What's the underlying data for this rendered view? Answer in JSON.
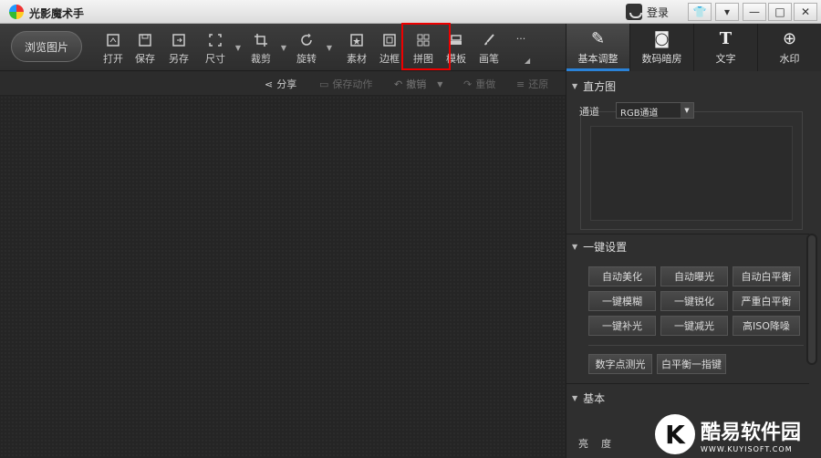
{
  "title_bar": {
    "app_title": "光影魔术手",
    "login_label": "登录",
    "btn_skin": "👕",
    "btn_menu": "▾",
    "btn_min": "—",
    "btn_max": "□",
    "btn_close": "✕"
  },
  "toolbar": {
    "browse_label": "浏览图片",
    "tools": [
      {
        "label": "打开",
        "icon": "open-icon"
      },
      {
        "label": "保存",
        "icon": "save-icon"
      },
      {
        "label": "另存",
        "icon": "save-as-icon"
      },
      {
        "label": "尺寸",
        "icon": "resize-icon"
      },
      {
        "label": "裁剪",
        "icon": "crop-icon"
      },
      {
        "label": "旋转",
        "icon": "rotate-icon"
      },
      {
        "label": "素材",
        "icon": "material-icon"
      },
      {
        "label": "边框",
        "icon": "frame-icon"
      },
      {
        "label": "拼图",
        "icon": "collage-icon"
      },
      {
        "label": "模板",
        "icon": "template-icon"
      },
      {
        "label": "画笔",
        "icon": "brush-icon"
      },
      {
        "label": "···",
        "icon": "more-icon"
      }
    ]
  },
  "subbar": {
    "share": "分享",
    "save_action": "保存动作",
    "undo": "撤销",
    "redo": "重做",
    "restore": "还原"
  },
  "right_tabs": [
    {
      "label": "基本调整",
      "icon": "adjust-icon",
      "active": true
    },
    {
      "label": "数码暗房",
      "icon": "camera-icon",
      "active": false
    },
    {
      "label": "文字",
      "icon": "text-icon",
      "active": false
    },
    {
      "label": "水印",
      "icon": "watermark-icon",
      "active": false
    }
  ],
  "histogram": {
    "title": "直方图",
    "channel_label": "通道",
    "channel_value": "RGB通道"
  },
  "one_click": {
    "title": "一键设置",
    "buttons": [
      "自动美化",
      "自动曝光",
      "自动白平衡",
      "一键模糊",
      "一键锐化",
      "严重白平衡",
      "一键补光",
      "一键减光",
      "高ISO降噪",
      "数字点测光",
      "白平衡一指键"
    ]
  },
  "basic": {
    "title": "基本",
    "brightness_label": "亮度"
  },
  "watermark": {
    "letter": "K",
    "main": "酷易软件园",
    "sub": "WWW.KUYISOFT.COM"
  },
  "colors": {
    "accent": "#2a82d8",
    "highlight": "#e00000"
  }
}
